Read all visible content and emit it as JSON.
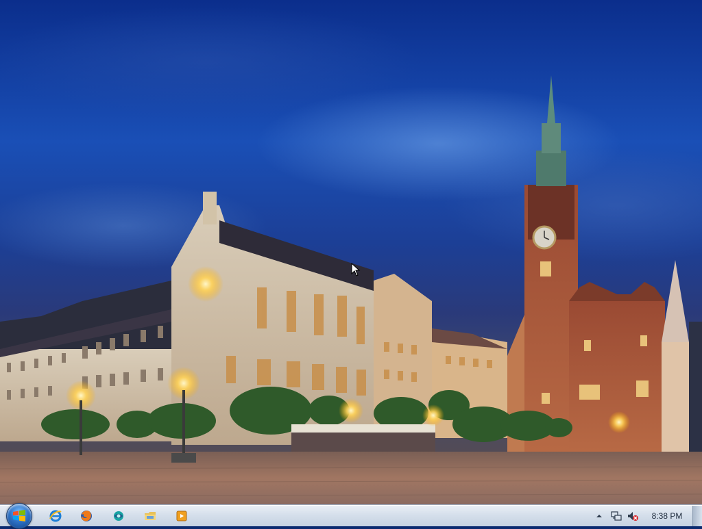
{
  "desktop": {
    "wallpaper": "city-square-at-dusk",
    "colors": {
      "sky": "#1a4fb6",
      "taskbar": "#d5dfeb"
    }
  },
  "taskbar": {
    "start_icon": "windows-start-icon",
    "pinned": [
      {
        "name": "internet-explorer-icon"
      },
      {
        "name": "firefox-icon"
      },
      {
        "name": "app-icon"
      },
      {
        "name": "file-explorer-icon"
      },
      {
        "name": "media-player-icon"
      }
    ],
    "tray": {
      "icons": [
        "show-hidden-icons-chevron",
        "network-icon",
        "volume-muted-icon"
      ],
      "clock": "8:38 PM"
    }
  }
}
